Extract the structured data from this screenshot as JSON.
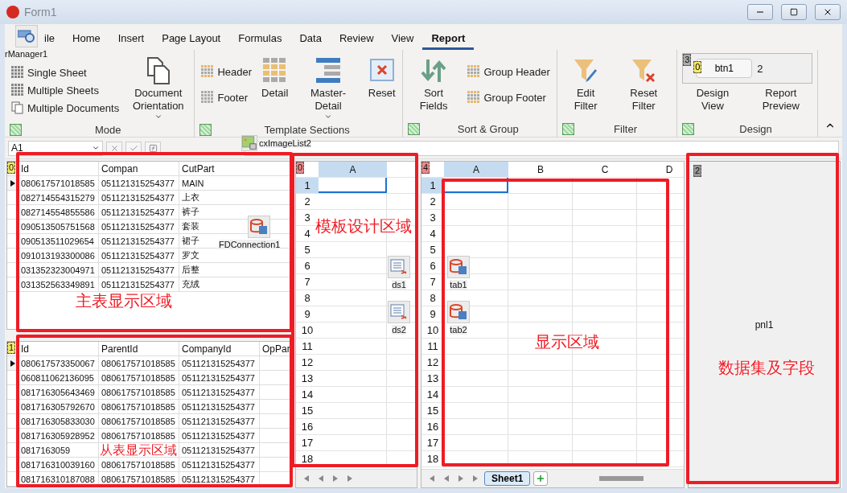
{
  "window": {
    "title": "Form1"
  },
  "ribbon": {
    "tabs": [
      {
        "label": "ile",
        "selected": false
      },
      {
        "label": "Home",
        "selected": false
      },
      {
        "label": "Insert",
        "selected": false
      },
      {
        "label": "Page Layout",
        "selected": false
      },
      {
        "label": "Formulas",
        "selected": false
      },
      {
        "label": "Data",
        "selected": false
      },
      {
        "label": "Review",
        "selected": false
      },
      {
        "label": "View",
        "selected": false
      },
      {
        "label": "Report",
        "selected": true
      }
    ],
    "groups": [
      {
        "title": "Mode",
        "columns": [
          {
            "kind": "stack",
            "items": [
              "Single Sheet",
              "Multiple Sheets",
              "Multiple Documents"
            ]
          },
          {
            "kind": "large",
            "label": "Document Orientation",
            "dropdown": true
          }
        ]
      },
      {
        "title": "Template Sections",
        "columns": [
          {
            "kind": "stack",
            "items": [
              "Header",
              "Footer"
            ]
          },
          {
            "kind": "large",
            "label": "Detail",
            "dropdown": false
          },
          {
            "kind": "large",
            "label": "Master-Detail",
            "dropdown": true
          },
          {
            "kind": "large",
            "label": "Reset",
            "dropdown": false
          }
        ]
      },
      {
        "title": "Sort & Group",
        "columns": [
          {
            "kind": "large",
            "label": "Sort Fields",
            "dropdown": false
          },
          {
            "kind": "stack",
            "items": [
              "Group Header",
              "Group Footer"
            ]
          }
        ]
      },
      {
        "title": "Filter",
        "columns": [
          {
            "kind": "large",
            "label": "Edit Filter",
            "dropdown": false
          },
          {
            "kind": "large",
            "label": "Reset Filter",
            "dropdown": false
          }
        ]
      },
      {
        "title": "Design",
        "columns": [
          {
            "kind": "large",
            "label": "Design View",
            "dropdown": false
          },
          {
            "kind": "large",
            "label": "Report Preview",
            "dropdown": false
          }
        ],
        "overlay": {
          "tag": "3",
          "button": {
            "label": "btn1",
            "tag": "0"
          },
          "text": "2"
        }
      }
    ]
  },
  "formula_bar": {
    "name_box": "A1"
  },
  "master_grid": {
    "tag": "0",
    "columns": [
      "Id",
      "Compan",
      "CutPart"
    ],
    "rows": [
      {
        "cells": [
          "080617571018585",
          "051121315254377",
          "MAIN"
        ],
        "selected": true
      },
      {
        "cells": [
          "082714554315279",
          "051121315254377",
          "上衣"
        ],
        "selected": false
      },
      {
        "cells": [
          "082714554855586",
          "051121315254377",
          "裤子"
        ],
        "selected": false
      },
      {
        "cells": [
          "090513505751568",
          "051121315254377",
          "套装"
        ],
        "selected": false
      },
      {
        "cells": [
          "090513511029654",
          "051121315254377",
          "裙子"
        ],
        "selected": false
      },
      {
        "cells": [
          "091013193300086",
          "051121315254377",
          "罗文"
        ],
        "selected": false
      },
      {
        "cells": [
          "031352323004971",
          "051121315254377",
          "后整"
        ],
        "selected": false
      },
      {
        "cells": [
          "031352563349891",
          "051121315254377",
          "充绒"
        ],
        "selected": false
      }
    ]
  },
  "detail_grid": {
    "tag": "1",
    "columns": [
      "Id",
      "ParentId",
      "CompanyId",
      "OpPar"
    ],
    "rows": [
      {
        "cells": [
          "080617573350067",
          "080617571018585",
          "051121315254377"
        ],
        "selected": true
      },
      {
        "cells": [
          "060811062136095",
          "080617571018585",
          "051121315254377"
        ],
        "selected": false
      },
      {
        "cells": [
          "081716305643469",
          "080617571018585",
          "051121315254377"
        ],
        "selected": false
      },
      {
        "cells": [
          "081716305792670",
          "080617571018585",
          "051121315254377"
        ],
        "selected": false
      },
      {
        "cells": [
          "081716305833030",
          "080617571018585",
          "051121315254377"
        ],
        "selected": false
      },
      {
        "cells": [
          "081716305928952",
          "080617571018585",
          "051121315254377"
        ],
        "selected": false
      },
      {
        "cells": [
          "0817163059",
          "",
          "051121315254377"
        ],
        "selected": false
      },
      {
        "cells": [
          "081716310039160",
          "080617571018585",
          "051121315254377"
        ],
        "selected": false
      },
      {
        "cells": [
          "081716310187088",
          "080617571018585",
          "051121315254377"
        ],
        "selected": false
      }
    ]
  },
  "template_sheet": {
    "tag": "0",
    "columns": [
      {
        "label": "A",
        "selected": true
      }
    ],
    "rows": [
      {
        "label": "1",
        "selected": true
      },
      {
        "label": "2",
        "selected": false
      },
      {
        "label": "3",
        "selected": false
      },
      {
        "label": "4",
        "selected": false
      },
      {
        "label": "5",
        "selected": false
      },
      {
        "label": "6",
        "selected": false
      },
      {
        "label": "7",
        "selected": false
      },
      {
        "label": "8",
        "selected": false
      },
      {
        "label": "9",
        "selected": false
      },
      {
        "label": "10",
        "selected": false
      },
      {
        "label": "11",
        "selected": false
      },
      {
        "label": "12",
        "selected": false
      },
      {
        "label": "13",
        "selected": false
      },
      {
        "label": "14",
        "selected": false
      },
      {
        "label": "15",
        "selected": false
      },
      {
        "label": "16",
        "selected": false
      },
      {
        "label": "17",
        "selected": false
      },
      {
        "label": "18",
        "selected": false
      }
    ]
  },
  "display_sheet": {
    "tag": "4",
    "columns": [
      {
        "label": "A",
        "selected": true
      },
      {
        "label": "B",
        "selected": false
      },
      {
        "label": "C",
        "selected": false
      },
      {
        "label": "D",
        "selected": false
      }
    ],
    "rows": [
      {
        "label": "1",
        "selected": true
      },
      {
        "label": "2",
        "selected": false
      },
      {
        "label": "3",
        "selected": false
      },
      {
        "label": "4",
        "selected": false
      },
      {
        "label": "5",
        "selected": false
      },
      {
        "label": "6",
        "selected": false
      },
      {
        "label": "7",
        "selected": false
      },
      {
        "label": "8",
        "selected": false
      },
      {
        "label": "9",
        "selected": false
      },
      {
        "label": "10",
        "selected": false
      },
      {
        "label": "11",
        "selected": false
      },
      {
        "label": "12",
        "selected": false
      },
      {
        "label": "13",
        "selected": false
      },
      {
        "label": "14",
        "selected": false
      },
      {
        "label": "15",
        "selected": false
      },
      {
        "label": "16",
        "selected": false
      },
      {
        "label": "17",
        "selected": false
      },
      {
        "label": "18",
        "selected": false
      }
    ],
    "sheet_tabs": [
      {
        "label": "Sheet1",
        "selected": true
      }
    ]
  },
  "panel": {
    "tag": "2",
    "caption": "pnl1"
  },
  "components": [
    {
      "name": "rManager1",
      "kind": "manager"
    },
    {
      "name": "cxImageList2",
      "kind": "images"
    },
    {
      "name": "FDConnection1",
      "kind": "connection"
    },
    {
      "name": "ds1",
      "kind": "dataset"
    },
    {
      "name": "ds2",
      "kind": "dataset"
    },
    {
      "name": "tab1",
      "kind": "table"
    },
    {
      "name": "tab2",
      "kind": "table"
    }
  ],
  "annotations": [
    {
      "label": "主表显示区域"
    },
    {
      "label": "从表显示区域"
    },
    {
      "label": "模板设计区域"
    },
    {
      "label": "显示区域"
    },
    {
      "label": "数据集及字段"
    }
  ]
}
